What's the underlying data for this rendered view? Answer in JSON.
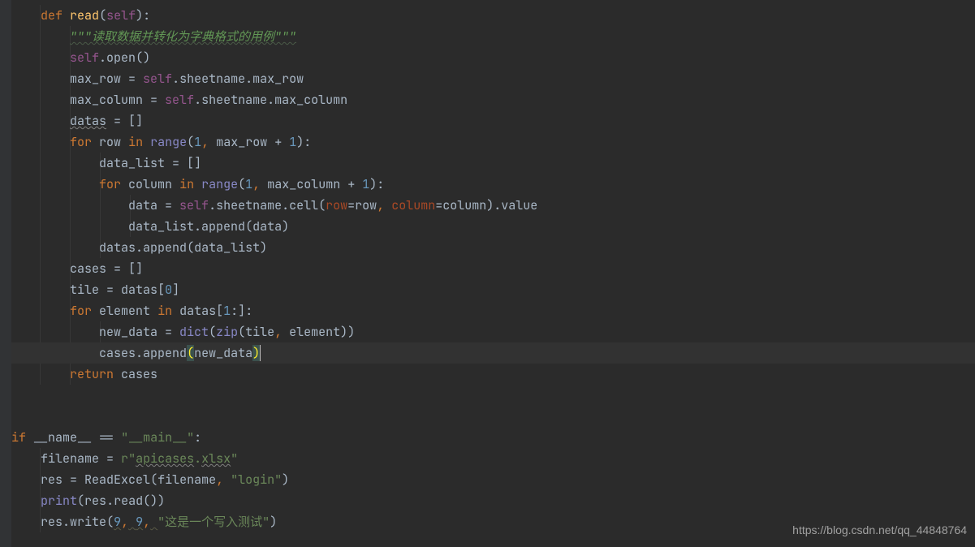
{
  "tokens": {
    "def": "def",
    "read_fn": "read",
    "self": "self",
    "docstring": "\"\"\"读取数据并转化为字典格式的用例\"\"\"",
    "open": "open",
    "max_row": "max_row",
    "sheetname": "sheetname",
    "max_column": "max_column",
    "datas": "datas",
    "for": "for",
    "row": "row",
    "in": "in",
    "range": "range",
    "one": "1",
    "data_list": "data_list",
    "column": "column",
    "data": "data",
    "cell": "cell",
    "row_param": "row",
    "col_param": "column",
    "value": "value",
    "append": "append",
    "cases": "cases",
    "tile": "tile",
    "zero": "0",
    "element": "element",
    "new_data": "new_data",
    "dict": "dict",
    "zip": "zip",
    "return": "return",
    "if": "if",
    "name": "__name__",
    "main": "\"__main__\"",
    "filename": "filename",
    "r": "r",
    "apicases": "apicases",
    "xlsx": "xlsx",
    "res": "res",
    "ReadExcel": "ReadExcel",
    "login": "\"login\"",
    "print": "print",
    "write": "write",
    "nine": "9",
    "write_test": "\"这是一个写入测试\"",
    "eq": " = ",
    "eqeq": " == ",
    "plus": " + ",
    "colon": ":",
    "lparen": "(",
    "rparen": ")",
    "lbrack": "[",
    "rbrack": "]",
    "comma": ", ",
    "dot": ".",
    "quote": "\""
  },
  "watermark": "https://blog.csdn.net/qq_44848764",
  "chart_data": {
    "type": "table",
    "title": "Python source code snippet",
    "lines": [
      "    def read(self):",
      "        \"\"\"读取数据并转化为字典格式的用例\"\"\"",
      "        self.open()",
      "        max_row = self.sheetname.max_row",
      "        max_column = self.sheetname.max_column",
      "        datas = []",
      "        for row in range(1, max_row + 1):",
      "            data_list = []",
      "            for column in range(1, max_column + 1):",
      "                data = self.sheetname.cell(row=row, column=column).value",
      "                data_list.append(data)",
      "            datas.append(data_list)",
      "        cases = []",
      "        tile = datas[0]",
      "        for element in datas[1:]:",
      "            new_data = dict(zip(tile, element))",
      "            cases.append(new_data)",
      "        return cases",
      "",
      "",
      "if __name__ == \"__main__\":",
      "    filename = r\"apicases.xlsx\"",
      "    res = ReadExcel(filename, \"login\")",
      "    print(res.read())",
      "    res.write(9, 9, \"这是一个写入测试\")"
    ]
  }
}
